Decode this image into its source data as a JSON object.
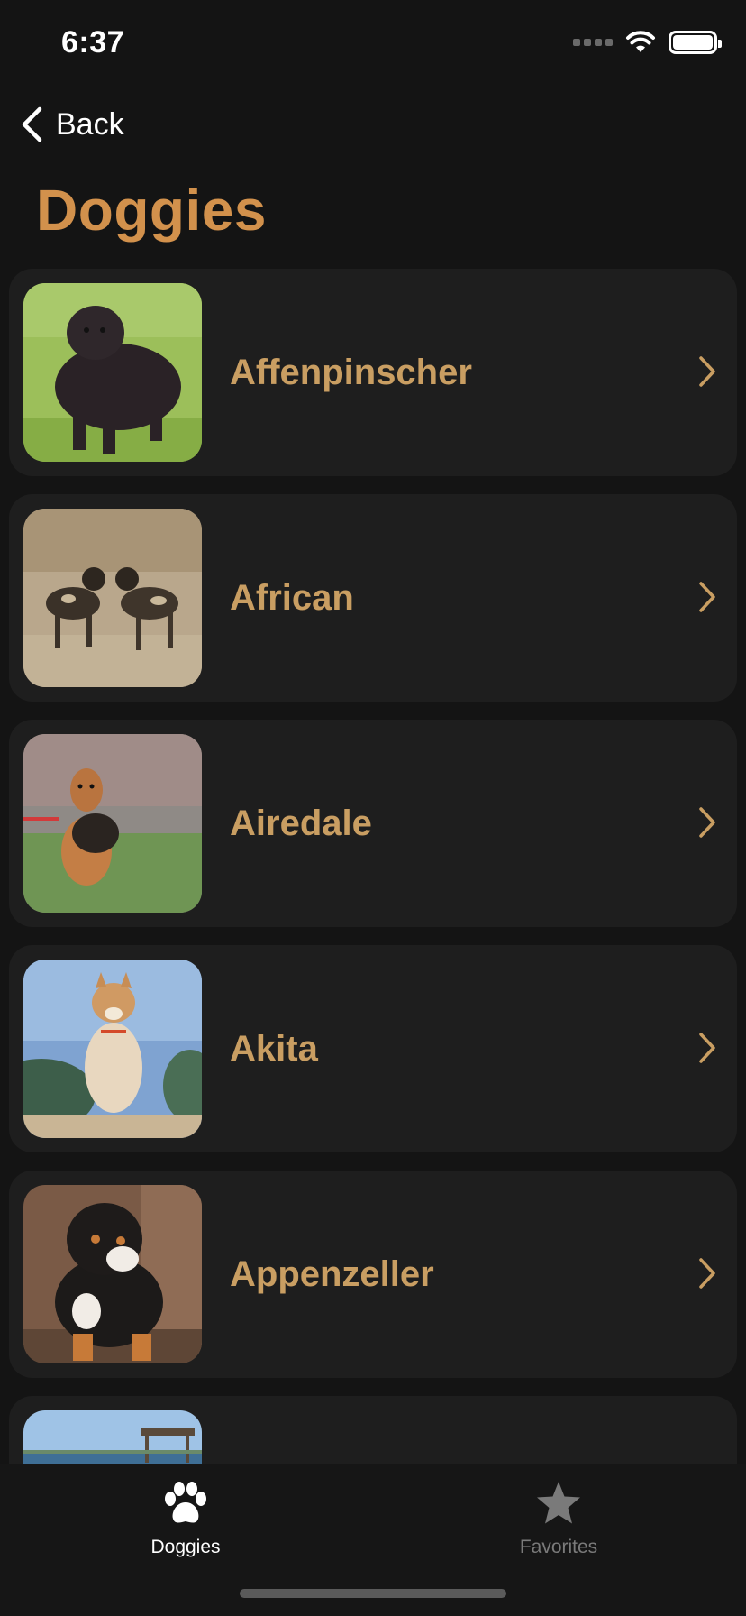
{
  "status_bar": {
    "time": "6:37"
  },
  "nav": {
    "back_label": "Back",
    "title": "Doggies"
  },
  "breeds": [
    {
      "name": "Affenpinscher"
    },
    {
      "name": "African"
    },
    {
      "name": "Airedale"
    },
    {
      "name": "Akita"
    },
    {
      "name": "Appenzeller"
    },
    {
      "name": ""
    }
  ],
  "tab_bar": {
    "tabs": [
      {
        "label": "Doggies",
        "icon": "paw-icon",
        "active": true
      },
      {
        "label": "Favorites",
        "icon": "star-icon",
        "active": false
      }
    ]
  },
  "colors": {
    "accent": "#d2914c",
    "row_label": "#c99e62",
    "background": "#141414",
    "row_background": "#1e1e1e",
    "tab_inactive": "#7a7a7a"
  }
}
